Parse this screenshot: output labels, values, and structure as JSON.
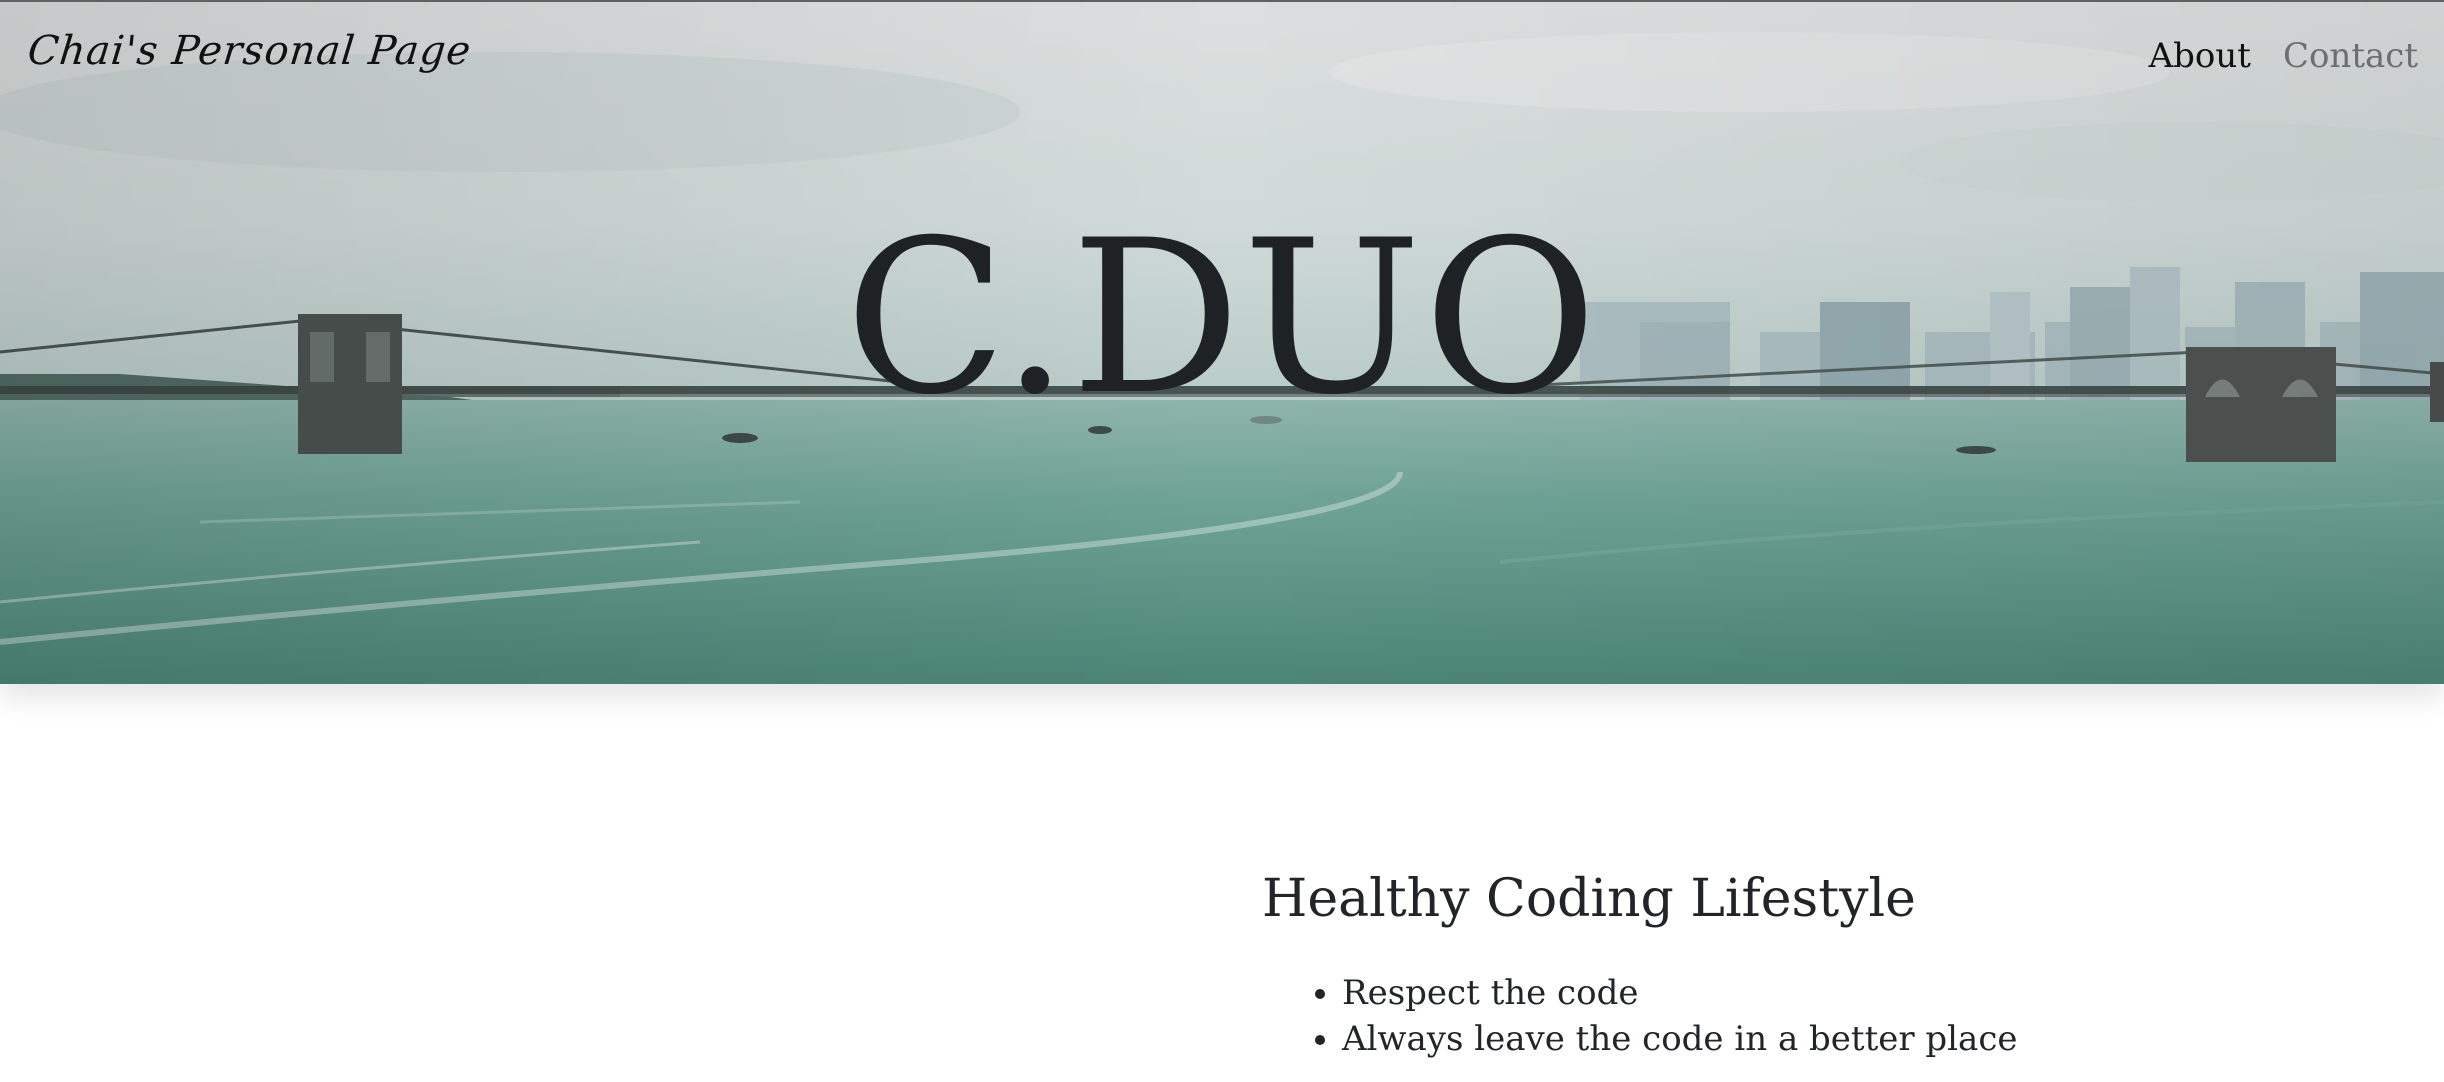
{
  "nav": {
    "brand": "Chai's Personal Page",
    "links": [
      {
        "label": "About"
      },
      {
        "label": "Contact"
      }
    ]
  },
  "hero": {
    "title": "C.DUO"
  },
  "main": {
    "heading": "Healthy Coding Lifestyle",
    "items": [
      "Respect the code",
      "Always leave the code in a better place"
    ]
  },
  "colors": {
    "text": "#212529",
    "nav_muted": "#6c6f70",
    "water": "#5e9a8c",
    "sky": "#d9e0df"
  }
}
